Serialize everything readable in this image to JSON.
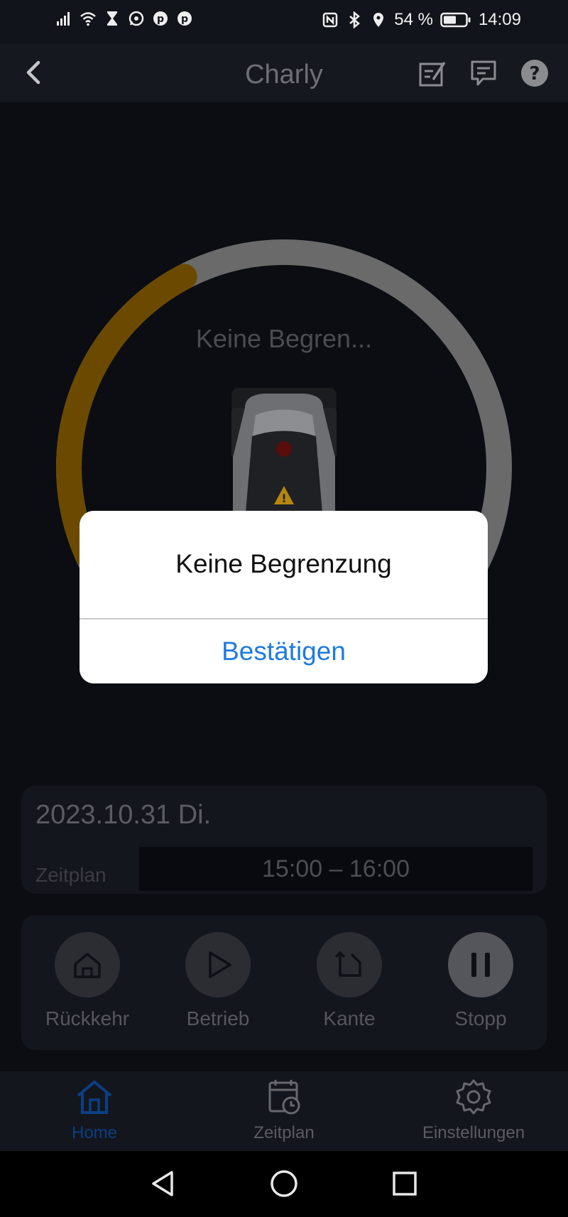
{
  "status_bar": {
    "battery_text": "54 %",
    "time": "14:09"
  },
  "header": {
    "title": "Charly"
  },
  "status_ring": {
    "label": "Keine Begren...",
    "progress_fraction": 0.24,
    "progress_color": "#6b4a00",
    "track_color": "#6a6a6a"
  },
  "schedule": {
    "date": "2023.10.31 Di.",
    "label": "Zeitplan",
    "time_range": "15:00 – 16:00"
  },
  "controls": {
    "return_label": "Rückkehr",
    "run_label": "Betrieb",
    "edge_label": "Kante",
    "stop_label": "Stopp"
  },
  "bottom_nav": {
    "home": "Home",
    "schedule": "Zeitplan",
    "settings": "Einstellungen",
    "active_color": "#0a3f85"
  },
  "dialog": {
    "message": "Keine Begrenzung",
    "confirm": "Bestätigen",
    "confirm_color": "#1f7ae0"
  }
}
